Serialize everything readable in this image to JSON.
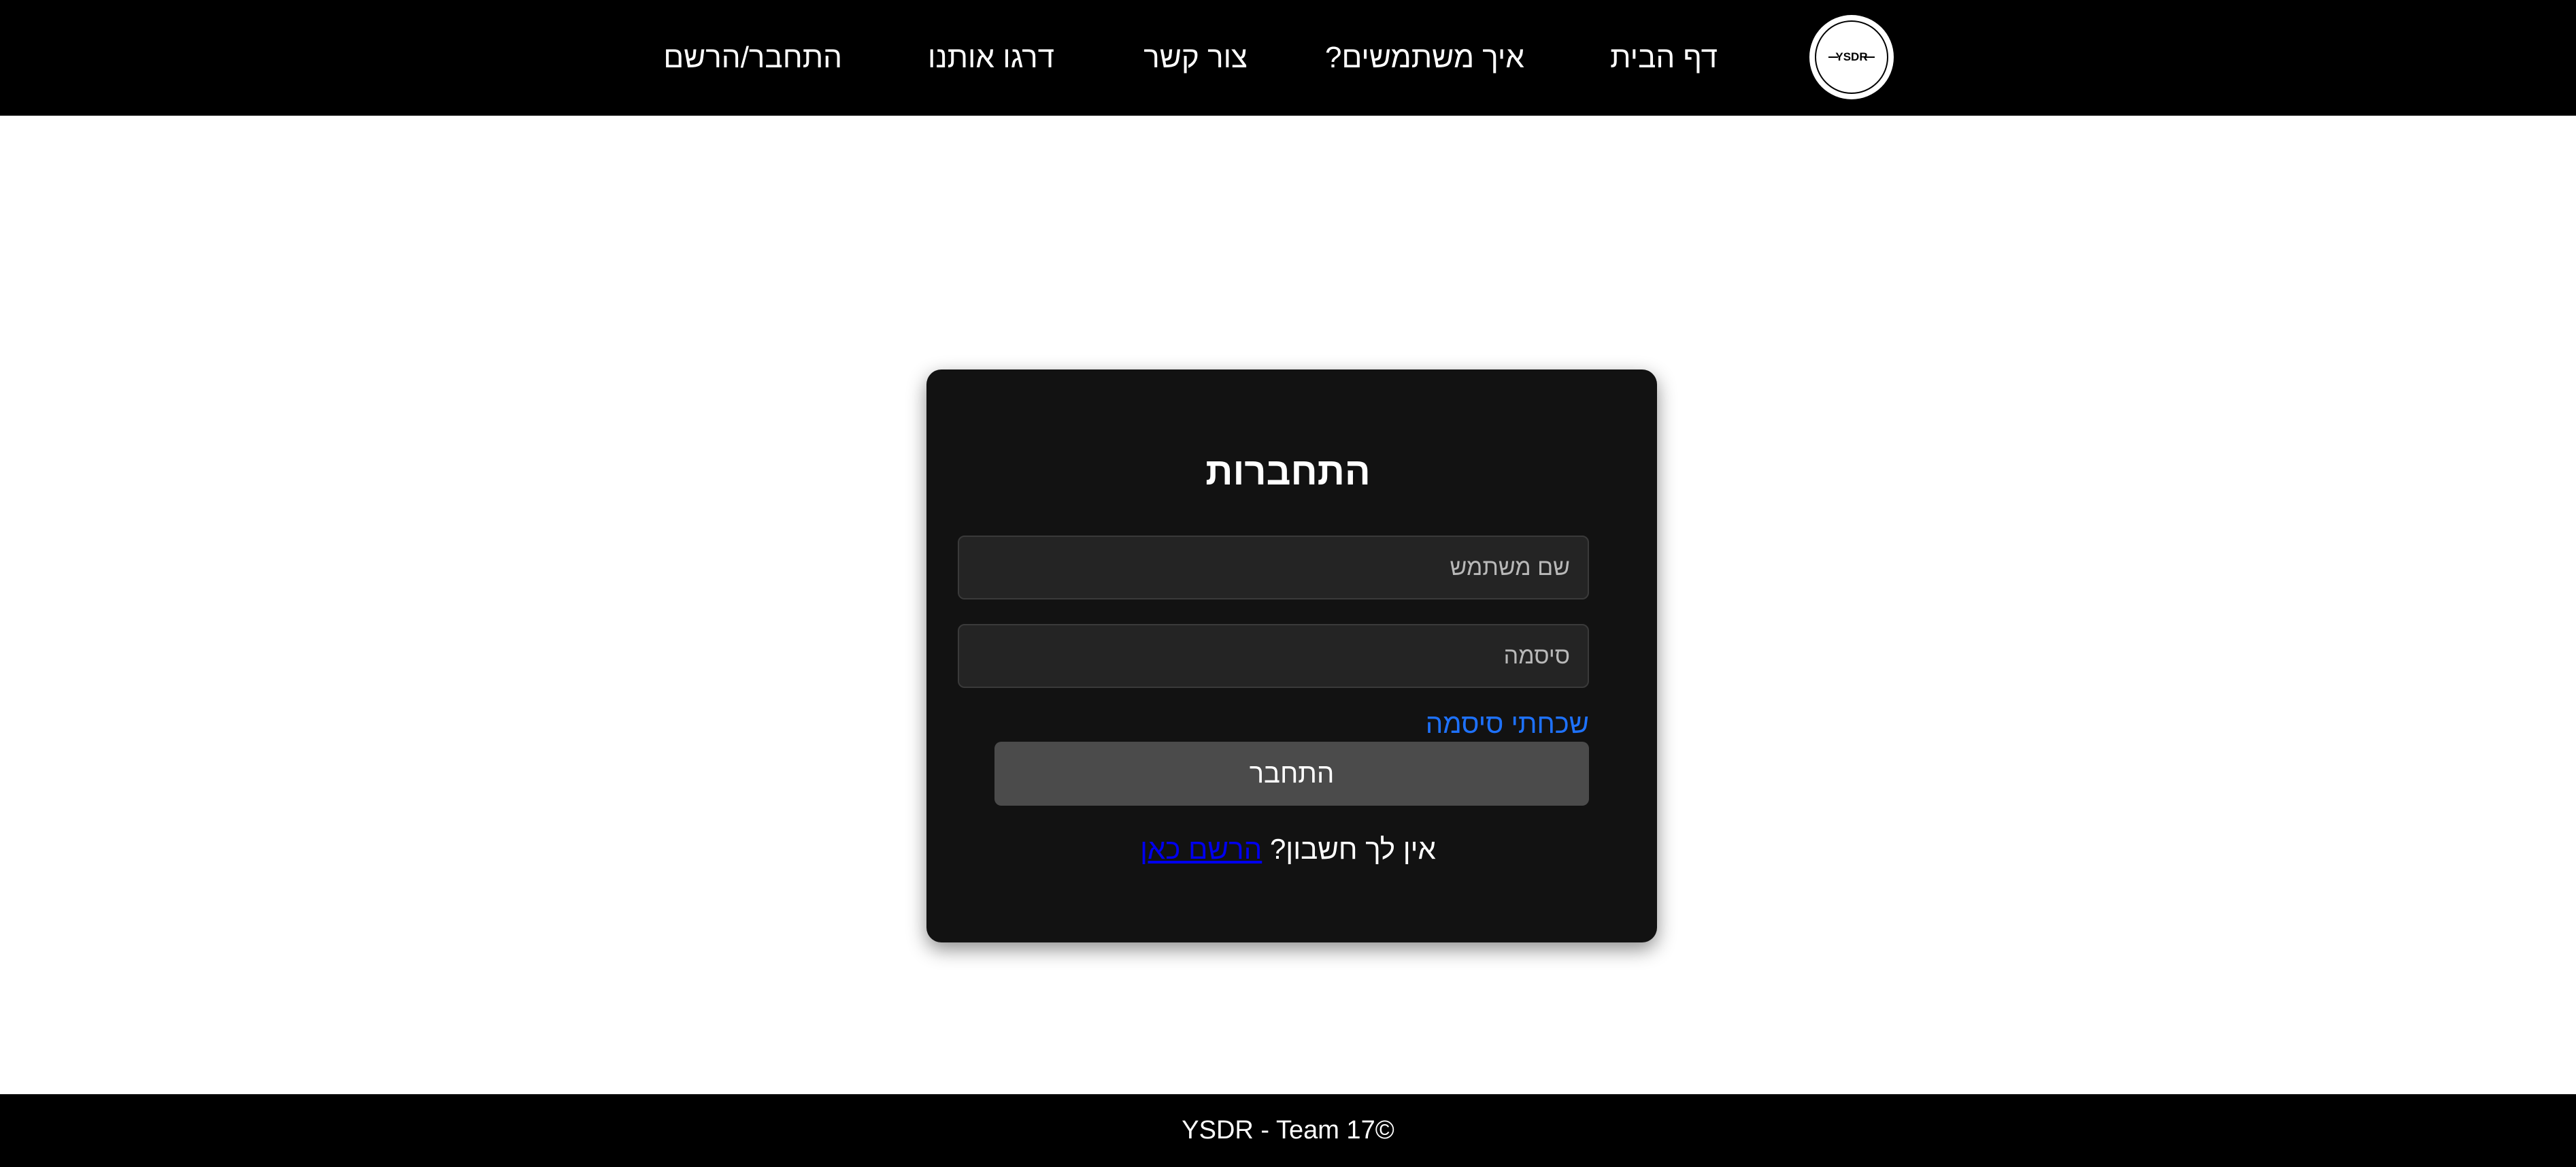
{
  "nav": {
    "logo_text": "YSDR",
    "items": [
      {
        "label": "דף הבית"
      },
      {
        "label": "איך משתמשים?"
      },
      {
        "label": "צור קשר"
      },
      {
        "label": "דרגו אותנו"
      },
      {
        "label": "התחבר/הרשם"
      }
    ]
  },
  "login": {
    "title": "התחברות",
    "username_placeholder": "שם משתמש",
    "password_placeholder": "סיסמה",
    "forgot_label": "שכחתי סיסמה",
    "submit_label": "התחבר",
    "no_account_text": "אין לך חשבון?",
    "register_link": "הרשם כאן"
  },
  "footer": {
    "text": "YSDR - Team 17©"
  },
  "colors": {
    "nav_bg": "#000000",
    "card_bg": "#121212",
    "input_bg": "#242424",
    "button_bg": "#4b4b4b",
    "link_blue": "#1e72ff",
    "register_link": "#0000ee"
  }
}
